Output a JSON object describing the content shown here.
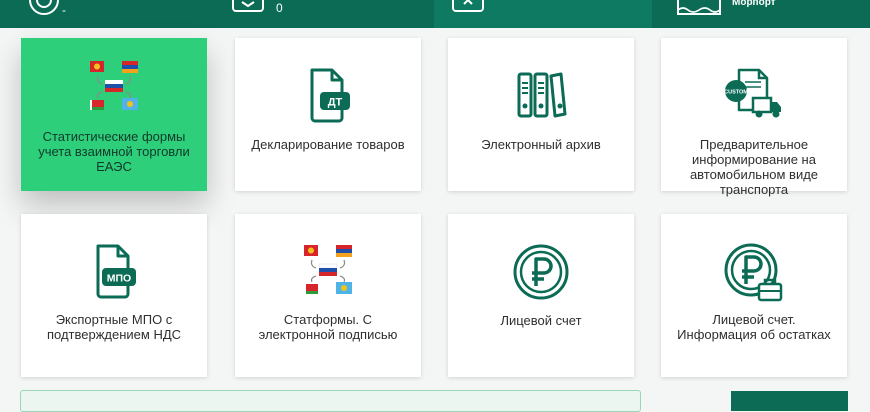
{
  "header": {
    "items": [
      {
        "label": "-"
      },
      {
        "label": "0"
      },
      {
        "label": ""
      },
      {
        "label": "Морпорт"
      }
    ]
  },
  "tiles": [
    {
      "label": "Статистические формы учета взаимной торговли ЕАЭС",
      "icon": "eaeu-flags-icon",
      "active": true
    },
    {
      "label": "Декларирование товаров",
      "icon": "declaration-dt-icon",
      "badge": "ДТ"
    },
    {
      "label": "Электронный архив",
      "icon": "archive-binders-icon"
    },
    {
      "label": "Предварительное информирование на автомобильном виде транспорта",
      "icon": "custom-truck-icon",
      "badge": "CUSTOM"
    },
    {
      "label": "Экспортные МПО с подтверждением НДС",
      "icon": "mpo-document-icon",
      "badge": "МПО"
    },
    {
      "label": "Статформы. С электронной подписью",
      "icon": "eaeu-flags-icon"
    },
    {
      "label": "Лицевой счет",
      "icon": "ruble-icon"
    },
    {
      "label": "Лицевой счет. Информация об остатках",
      "icon": "ruble-briefcase-icon"
    }
  ],
  "colors": {
    "header_bg": "#0b6b55",
    "accent": "#2ecf7a",
    "icon_green": "#0b6b55"
  }
}
